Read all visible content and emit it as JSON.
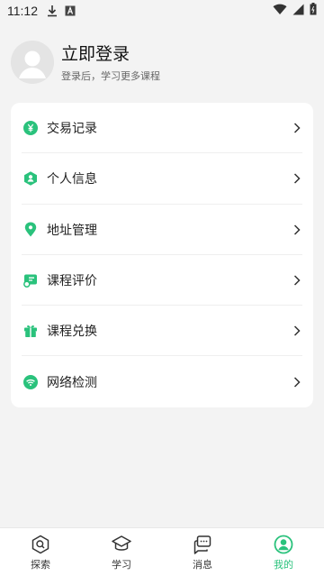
{
  "status_bar": {
    "time": "11:12",
    "icons": [
      "download-icon",
      "a-icon",
      "wifi-icon",
      "signal-icon",
      "battery-icon"
    ]
  },
  "profile": {
    "title": "立即登录",
    "subtitle": "登录后，学习更多课程"
  },
  "menu": [
    {
      "label": "交易记录",
      "icon": "yen-icon"
    },
    {
      "label": "个人信息",
      "icon": "person-icon"
    },
    {
      "label": "地址管理",
      "icon": "location-icon"
    },
    {
      "label": "课程评价",
      "icon": "review-icon"
    },
    {
      "label": "课程兑换",
      "icon": "gift-icon"
    },
    {
      "label": "网络检测",
      "icon": "network-icon"
    }
  ],
  "tabs": [
    {
      "label": "探索",
      "icon": "explore-icon",
      "active": false
    },
    {
      "label": "学习",
      "icon": "graduation-cap-icon",
      "active": false
    },
    {
      "label": "消息",
      "icon": "chat-icon",
      "active": false
    },
    {
      "label": "我的",
      "icon": "profile-icon",
      "active": true
    }
  ],
  "colors": {
    "accent": "#2ac27c",
    "background": "#f3f3f3"
  }
}
